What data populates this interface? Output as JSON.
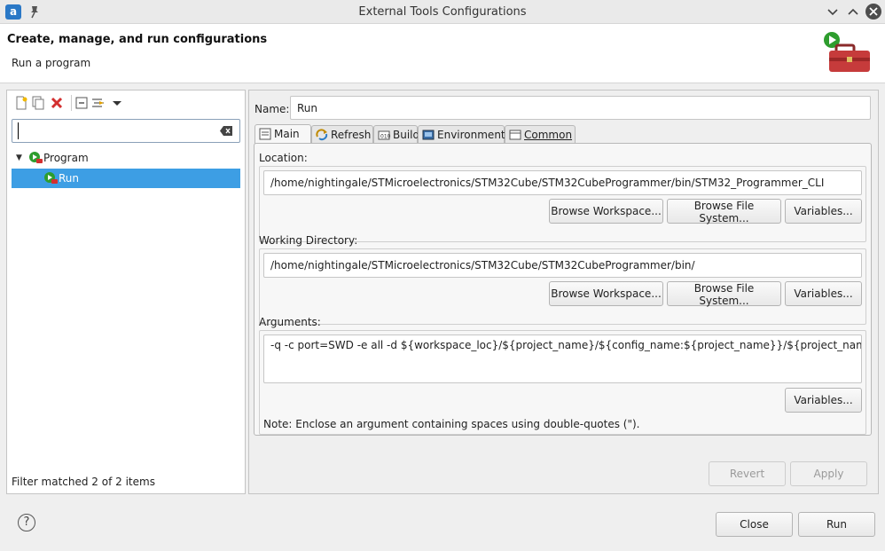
{
  "window": {
    "title": "External Tools Configurations",
    "app_icon_letter": "a"
  },
  "header": {
    "title": "Create, manage, and run configurations",
    "subtitle": "Run a program"
  },
  "left": {
    "filter": {
      "value": "",
      "placeholder": ""
    },
    "tree": [
      {
        "label": "Program",
        "expanded": true,
        "selected": false
      },
      {
        "label": "Run",
        "selected": true
      }
    ],
    "status": "Filter matched 2 of 2 items"
  },
  "right": {
    "name_label": "Name:",
    "name_value": "Run",
    "tabs": [
      {
        "label": "Main",
        "icon": "main-tab-icon",
        "active": true
      },
      {
        "label": "Refresh",
        "icon": "refresh-icon"
      },
      {
        "label": "Build",
        "icon": "build-icon"
      },
      {
        "label": "Environment",
        "icon": "environment-icon"
      },
      {
        "label": "Common",
        "icon": "common-icon"
      }
    ],
    "location": {
      "label": "Location:",
      "value": "/home/nightingale/STMicroelectronics/STM32Cube/STM32CubeProgrammer/bin/STM32_Programmer_CLI",
      "browse_workspace": "Browse Workspace...",
      "browse_fs": "Browse File System...",
      "variables": "Variables..."
    },
    "workdir": {
      "label": "Working Directory:",
      "value": "/home/nightingale/STMicroelectronics/STM32Cube/STM32CubeProgrammer/bin/",
      "browse_workspace": "Browse Workspace...",
      "browse_fs": "Browse File System...",
      "variables": "Variables..."
    },
    "arguments": {
      "label": "Arguments:",
      "value": "-q -c port=SWD -e all -d ${workspace_loc}/${project_name}/${config_name:${project_name}}/${project_name}.elf -v -rst",
      "variables": "Variables...",
      "note": "Note: Enclose an argument containing spaces using double-quotes (\")."
    },
    "revert": "Revert",
    "apply": "Apply"
  },
  "footer": {
    "help": "?",
    "close": "Close",
    "run": "Run"
  },
  "colors": {
    "selection": "#3d9ee4",
    "error_red": "#d32f2f",
    "run_green": "#2e9d2e"
  }
}
